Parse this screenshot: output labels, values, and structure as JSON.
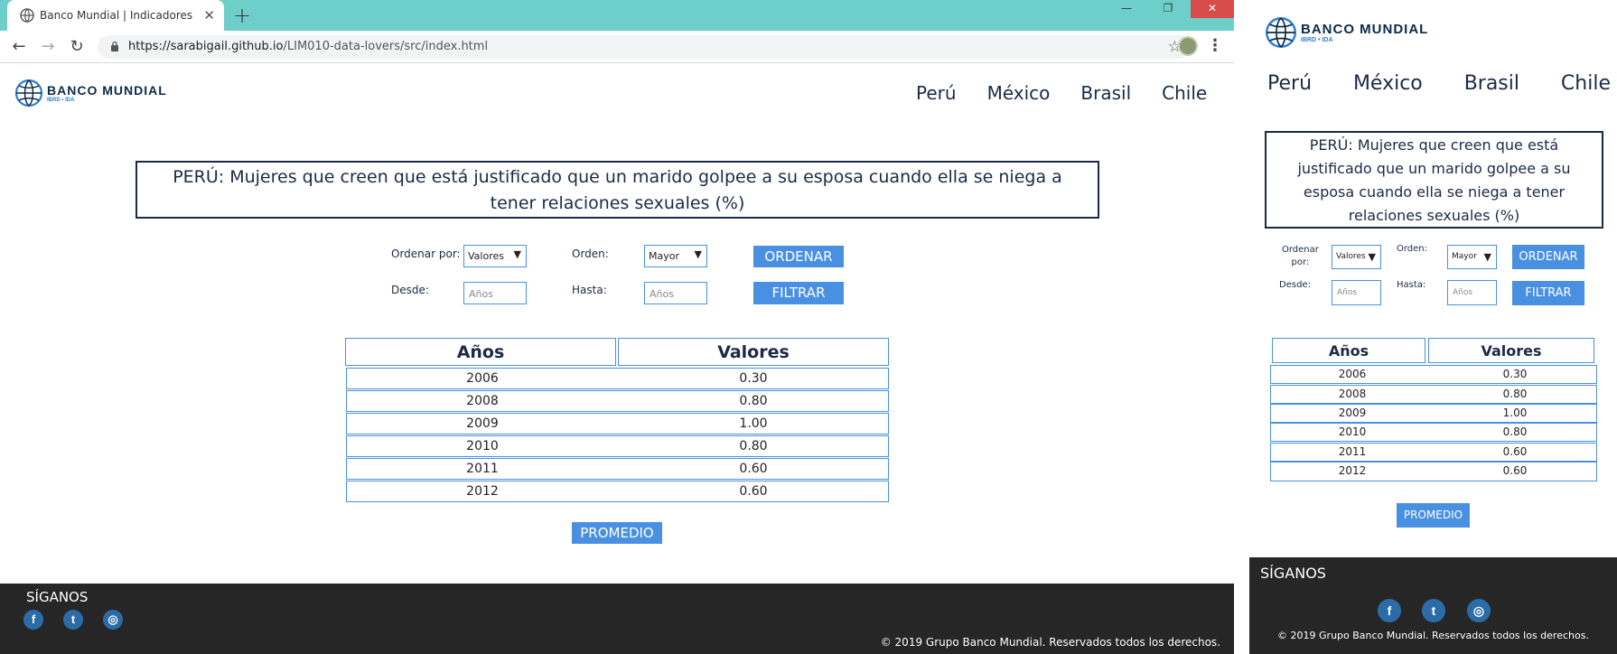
{
  "browser": {
    "tab_title": "Banco Mundial | Indicadores",
    "url_host": "https://sarabigail.github.io",
    "url_path": "/LIM010-data-lovers/src/index.html",
    "minimize": "—",
    "restore": "❐",
    "close": "✕"
  },
  "logo": {
    "name": "BANCO  MUNDIAL",
    "sub": "IBRD • IDA"
  },
  "nav": {
    "items": [
      "Perú",
      "México",
      "Brasil",
      "Chile"
    ]
  },
  "title": "PERÚ: Mujeres que creen que está justificado que un marido golpee a su esposa cuando ella se niega a tener relaciones sexuales (%)",
  "controls": {
    "order_by_label": "Ordenar por:",
    "order_by_value": "Valores",
    "order_label": "Orden:",
    "order_value": "Mayor",
    "sort_button": "ORDENAR",
    "from_label": "Desde:",
    "from_placeholder": "Años",
    "to_label": "Hasta:",
    "to_placeholder": "Años",
    "filter_button": "FILTRAR"
  },
  "table": {
    "headers": [
      "Años",
      "Valores"
    ],
    "rows": [
      [
        "2006",
        "0.30"
      ],
      [
        "2008",
        "0.80"
      ],
      [
        "2009",
        "1.00"
      ],
      [
        "2010",
        "0.80"
      ],
      [
        "2011",
        "0.60"
      ],
      [
        "2012",
        "0.60"
      ]
    ]
  },
  "average_button": "PROMEDIO",
  "footer": {
    "follow": "SÍGANOS",
    "copyright": "© 2019 Grupo Banco Mundial. Reservados todos los derechos."
  },
  "mobile": {
    "order_by_label_l1": "Ordenar",
    "order_by_label_l2": "por:"
  },
  "colors": {
    "accent": "#4a90e2",
    "navy": "#1b2a46",
    "footer": "#262626",
    "tabstrip": "#6ecfca"
  }
}
